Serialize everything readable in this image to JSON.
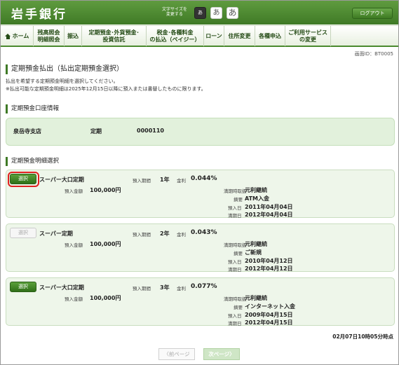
{
  "header": {
    "logo": "岩手銀行",
    "font_size_label_1": "文字サイズを",
    "font_size_label_2": "変更する",
    "font_sizes": [
      "あ",
      "あ",
      "あ"
    ],
    "logout": "ログアウト"
  },
  "nav": {
    "items": [
      {
        "label": "ホーム"
      },
      {
        "label": "残高照会\n明細照会"
      },
      {
        "label": "振込"
      },
      {
        "label": "定期預金･外貨預金･\n投資信託"
      },
      {
        "label": "税金･各種料金\nの払込（ペイジー）"
      },
      {
        "label": "ローン"
      },
      {
        "label": "住所変更"
      },
      {
        "label": "各種申込"
      },
      {
        "label": "ご利用サービス\nの変更"
      }
    ]
  },
  "screen_id": "画面ID：BT0005",
  "page_title": "定期預金払出（払出定期預金選択）",
  "desc_1": "払出を希望する定期預金明細を選択してください。",
  "desc_2": "※払出可能な定期預金明細は2025年12月15日以降に預入または書替したものに限ります。",
  "account_section": {
    "title": "定期預金口座情報",
    "branch": "泉岳寺支店",
    "type": "定期",
    "number": "0000110"
  },
  "detail_section_title": "定期預金明細選択",
  "select_label": "選択",
  "labels": {
    "period": "預入期間",
    "rate": "金利",
    "amount": "預入金額",
    "maturity_handling": "満期時取扱",
    "summary": "摘要",
    "deposit_date": "預入日",
    "maturity_date": "満期日"
  },
  "deposits": [
    {
      "name": "スーパー大口定期",
      "period": "1年",
      "rate": "0.044%",
      "amount": "100,000円",
      "maturity_handling": "元利継続",
      "summary": "ATM入金",
      "deposit_date": "2011年04月04日",
      "maturity_date": "2012年04月04日",
      "enabled": true
    },
    {
      "name": "スーパー定期",
      "period": "2年",
      "rate": "0.043%",
      "amount": "100,000円",
      "maturity_handling": "元利継続",
      "summary": "ご新規",
      "deposit_date": "2010年04月12日",
      "maturity_date": "2012年04月12日",
      "enabled": false
    },
    {
      "name": "スーパー大口定期",
      "period": "3年",
      "rate": "0.077%",
      "amount": "100,000円",
      "maturity_handling": "元利継続",
      "summary": "インターネット入金",
      "deposit_date": "2009年04月15日",
      "maturity_date": "2012年04月15日",
      "enabled": true
    }
  ],
  "timestamp": "02月07日10時05分時点",
  "pager": {
    "prev": "前ページ",
    "next": "次ページ"
  }
}
